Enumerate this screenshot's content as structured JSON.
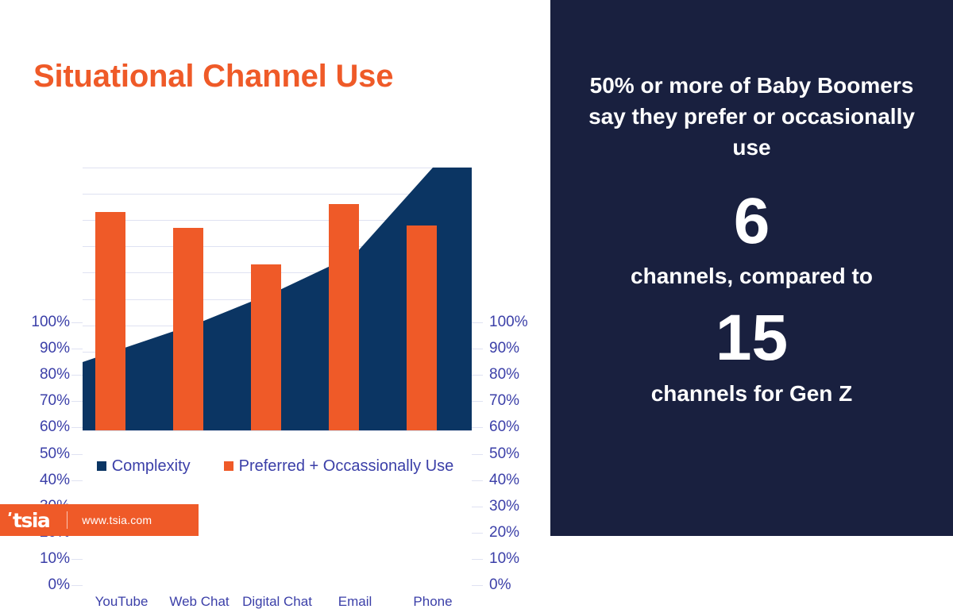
{
  "slide": {
    "title": "Situational Channel Use",
    "title_color": "#ef5a28",
    "background": "#ffffff"
  },
  "chart_data": {
    "type": "bar",
    "title": "Situational Channel Use",
    "categories": [
      "YouTube",
      "Web Chat",
      "Digital Chat",
      "Email",
      "Phone"
    ],
    "series": [
      {
        "name": "Complexity",
        "type": "area",
        "color": "#0b3563",
        "values": [
          31,
          41,
          53,
          67,
          100
        ]
      },
      {
        "name": "Preferred + Occassionally Use",
        "type": "bar",
        "color": "#ef5a28",
        "values": [
          83,
          77,
          63,
          86,
          78
        ]
      }
    ],
    "xlabel": "",
    "ylabel": "",
    "ylim": [
      0,
      100
    ],
    "ytick_values": [
      0,
      10,
      20,
      30,
      40,
      50,
      60,
      70,
      80,
      90,
      100
    ],
    "ytick_labels": [
      "0%",
      "10%",
      "20%",
      "30%",
      "40%",
      "50%",
      "60%",
      "70%",
      "80%",
      "90%",
      "100%"
    ],
    "dual_y_axis": true,
    "grid": true,
    "legend_position": "bottom",
    "axis_text_color": "#3b3fa8",
    "gridline_color": "#dfe2f2"
  },
  "legend": {
    "items": [
      {
        "label": "Complexity",
        "color": "#0b3563"
      },
      {
        "label": "Preferred + Occassionally Use",
        "color": "#ef5a28"
      }
    ]
  },
  "callout": {
    "lead": "50% or more of Baby Boomers say they prefer or occasionally use",
    "number_1": "6",
    "middle": "channels, compared to",
    "number_2": "15",
    "tail": "channels for Gen Z",
    "background": "#19203f",
    "text_color": "#ffffff"
  },
  "footer": {
    "logo_text": "tsia",
    "url": "www.tsia.com",
    "background": "#ef5a28"
  }
}
